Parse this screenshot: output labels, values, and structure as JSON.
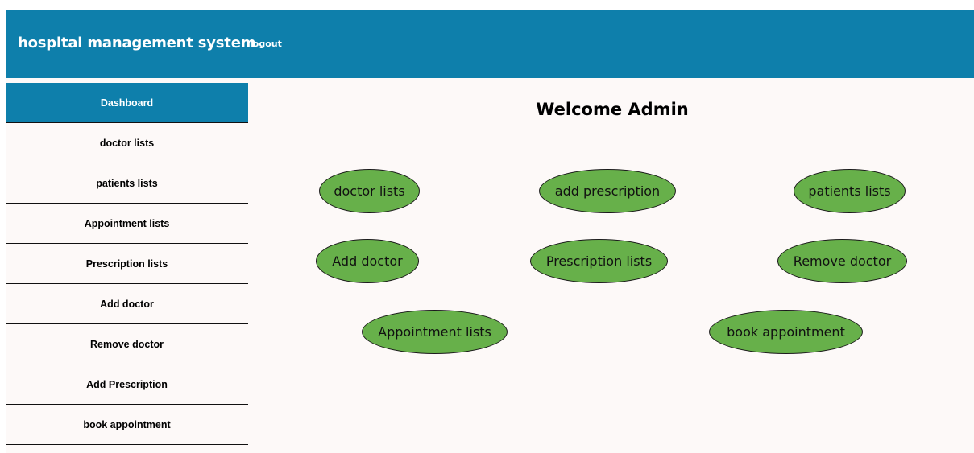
{
  "header": {
    "title": "hospital management system",
    "logout_label": "logout"
  },
  "sidebar": {
    "items": [
      {
        "label": "Dashboard",
        "active": true
      },
      {
        "label": "doctor lists"
      },
      {
        "label": "patients lists"
      },
      {
        "label": "Appointment lists"
      },
      {
        "label": "Prescription lists"
      },
      {
        "label": "Add doctor"
      },
      {
        "label": "Remove doctor"
      },
      {
        "label": "Add Prescription"
      },
      {
        "label": "book appointment"
      }
    ]
  },
  "main": {
    "welcome": "Welcome Admin",
    "buttons": [
      {
        "label": "doctor lists"
      },
      {
        "label": "add prescription"
      },
      {
        "label": "patients lists"
      },
      {
        "label": "Add doctor"
      },
      {
        "label": "Prescription lists"
      },
      {
        "label": "Remove doctor"
      },
      {
        "label": "Appointment lists"
      },
      {
        "label": "book appointment"
      }
    ]
  },
  "colors": {
    "primary": "#0e7fab",
    "button_green": "#67b04a",
    "content_bg": "#fdf9f8"
  }
}
